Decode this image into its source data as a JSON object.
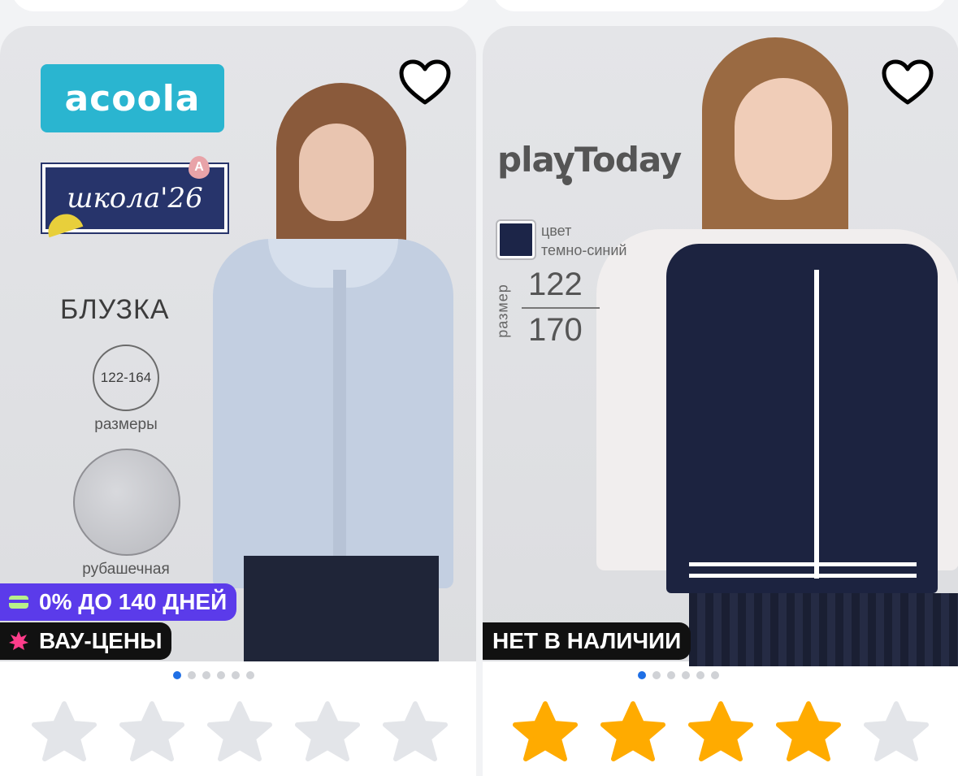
{
  "cards": [
    {
      "brand_logo_text": "acoola",
      "collection_text": "школа'26",
      "collection_badge": "A",
      "product_type": "БЛУЗКА",
      "sizes": "122-164",
      "sizes_caption": "размеры",
      "fabric_caption": "рубашечная",
      "badges": {
        "installment": "0% ДО 140 ДНЕЙ",
        "promo": "ВАУ-ЦЕНЫ"
      },
      "carousel": {
        "count": 6,
        "active": 0
      },
      "rating": 0,
      "colors": {
        "installment_bg": "#5b3bea",
        "promo_bg": "#111111",
        "promo_icon": "#ff3d8b"
      }
    },
    {
      "brand_logo_text": "playToday",
      "color_label_line1": "цвет",
      "color_label_line2": "темно-синий",
      "size_label": "размер",
      "size_top": "122",
      "size_bottom": "170",
      "badges": {
        "stock": "НЕТ В НАЛИЧИИ"
      },
      "carousel": {
        "count": 6,
        "active": 0
      },
      "rating": 4,
      "colors": {
        "swatch": "#1c2548"
      }
    }
  ],
  "icons": {
    "favorite": "heart-outline-icon",
    "star": "star-icon",
    "installment": "card-icon",
    "promo": "burst-icon"
  },
  "colors": {
    "star_filled": "#ffab00",
    "star_empty": "#e3e5e9",
    "dot_active": "#1f6fe5"
  }
}
